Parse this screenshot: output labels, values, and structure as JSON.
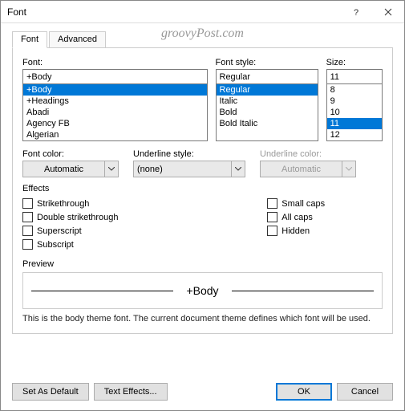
{
  "dialog": {
    "title": "Font",
    "tabs": {
      "font": "Font",
      "advanced": "Advanced"
    },
    "watermark": "groovyPost.com"
  },
  "font_section": {
    "label": "Font:",
    "value": "+Body",
    "items": [
      "+Body",
      "+Headings",
      "Abadi",
      "Agency FB",
      "Algerian"
    ],
    "selected": "+Body"
  },
  "style_section": {
    "label": "Font style:",
    "value": "Regular",
    "items": [
      "Regular",
      "Italic",
      "Bold",
      "Bold Italic"
    ],
    "selected": "Regular"
  },
  "size_section": {
    "label": "Size:",
    "value": "11",
    "items": [
      "8",
      "9",
      "10",
      "11",
      "12"
    ],
    "selected": "11"
  },
  "color_row": {
    "font_color": {
      "label": "Font color:",
      "value": "Automatic"
    },
    "underline_style": {
      "label": "Underline style:",
      "value": "(none)"
    },
    "underline_color": {
      "label": "Underline color:",
      "value": "Automatic"
    }
  },
  "effects": {
    "label": "Effects",
    "strikethrough": "Strikethrough",
    "double_strikethrough": "Double strikethrough",
    "superscript": "Superscript",
    "subscript": "Subscript",
    "small_caps": "Small caps",
    "all_caps": "All caps",
    "hidden": "Hidden"
  },
  "preview": {
    "label": "Preview",
    "text": "+Body",
    "note": "This is the body theme font. The current document theme defines which font will be used."
  },
  "buttons": {
    "set_default": "Set As Default",
    "text_effects": "Text Effects...",
    "ok": "OK",
    "cancel": "Cancel"
  }
}
